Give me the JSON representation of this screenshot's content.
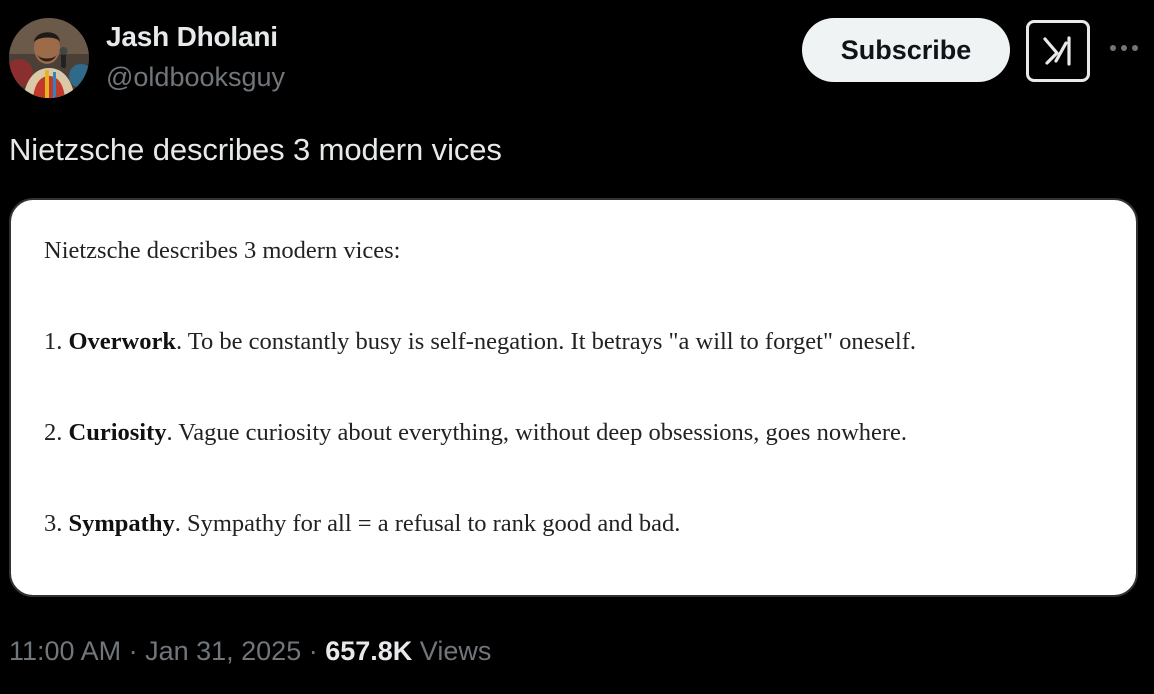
{
  "author": {
    "name": "Jash Dholani",
    "handle": "@oldbooksguy"
  },
  "actions": {
    "subscribe_label": "Subscribe",
    "grok_icon": "grok-icon",
    "more_icon": "more-icon"
  },
  "tweet": {
    "text": "Nietzsche describes 3 modern vices"
  },
  "media": {
    "intro": "Nietzsche describes 3 modern vices:",
    "items": [
      {
        "number": "1.",
        "term": "Overwork",
        "rest": ". To be constantly busy is self-negation. It betrays \"a will to forget\" oneself."
      },
      {
        "number": "2.",
        "term": "Curiosity",
        "rest": ". Vague curiosity about everything, without deep obsessions, goes nowhere."
      },
      {
        "number": "3.",
        "term": "Sympathy",
        "rest": ". Sympathy for all = a refusal to rank good and bad."
      }
    ]
  },
  "meta": {
    "time": "11:00 AM",
    "separator": " · ",
    "date": "Jan 31, 2025",
    "views_count": "657.8K",
    "views_label": " Views"
  },
  "colors": {
    "background": "#000000",
    "primary_text": "#e7e9ea",
    "secondary_text": "#71767b",
    "subscribe_bg": "#eff3f4",
    "card_bg": "#ffffff"
  }
}
